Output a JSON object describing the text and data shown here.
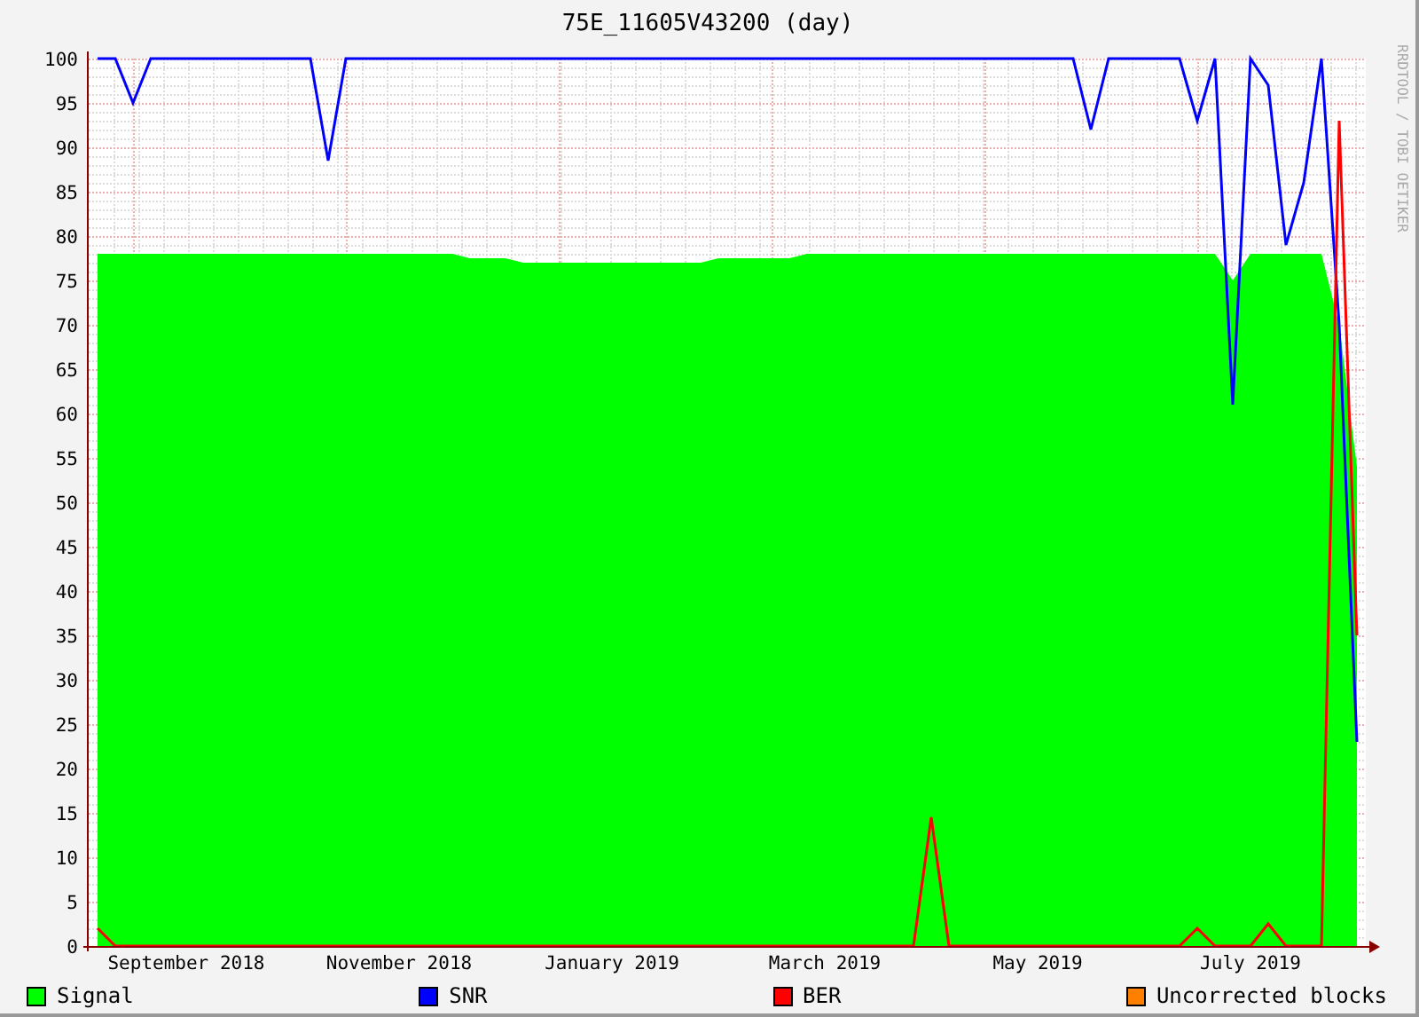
{
  "graph": {
    "title": "75E_11605V43200 (day)",
    "credit": "RRDTOOL / TOBI OETIKER",
    "chart_data": {
      "type": "area",
      "categories": [
        null,
        null,
        null,
        null,
        null,
        "September 2018",
        null,
        null,
        null,
        null,
        null,
        null,
        null,
        null,
        null,
        null,
        null,
        "November 2018",
        null,
        null,
        null,
        null,
        null,
        null,
        null,
        null,
        null,
        null,
        null,
        "January 2019",
        null,
        null,
        null,
        null,
        null,
        null,
        null,
        null,
        null,
        null,
        null,
        "March 2019",
        null,
        null,
        null,
        null,
        null,
        null,
        null,
        null,
        null,
        null,
        null,
        "May 2019",
        null,
        null,
        null,
        null,
        null,
        null,
        null,
        null,
        null,
        null,
        null,
        "July 2019",
        null,
        null,
        null,
        null,
        null,
        null
      ],
      "series": [
        {
          "name": "Signal",
          "type": "area",
          "color": "#00ff00",
          "values": [
            78,
            78,
            78,
            78,
            78,
            78,
            78,
            78,
            78,
            78,
            78,
            78,
            78,
            78,
            78,
            78,
            78,
            78,
            78,
            78,
            78,
            77.5,
            77.5,
            77.5,
            77,
            77,
            77,
            77,
            77,
            77,
            77,
            77,
            77,
            77,
            77,
            77.5,
            77.5,
            77.5,
            77.5,
            77.5,
            78,
            78,
            78,
            78,
            78,
            78,
            78,
            78,
            78,
            78,
            78,
            78,
            78,
            78,
            78,
            78,
            78,
            78,
            78,
            78,
            78,
            78,
            78,
            78,
            75,
            78,
            78,
            78,
            78,
            78,
            70,
            54
          ]
        },
        {
          "name": "SNR",
          "type": "line",
          "color": "#0000ff",
          "values": [
            100,
            100,
            95,
            100,
            100,
            100,
            100,
            100,
            100,
            100,
            100,
            100,
            100,
            88.5,
            100,
            100,
            100,
            100,
            100,
            100,
            100,
            100,
            100,
            100,
            100,
            100,
            100,
            100,
            100,
            100,
            100,
            100,
            100,
            100,
            100,
            100,
            100,
            100,
            100,
            100,
            100,
            100,
            100,
            100,
            100,
            100,
            100,
            100,
            100,
            100,
            100,
            100,
            100,
            100,
            100,
            100,
            92,
            100,
            100,
            100,
            100,
            100,
            93,
            100,
            61,
            100,
            97,
            79,
            86,
            100,
            70,
            23
          ]
        },
        {
          "name": "BER",
          "type": "line",
          "color": "#ff0000",
          "values": [
            2,
            0,
            0,
            0,
            0,
            0,
            0,
            0,
            0,
            0,
            0,
            0,
            0,
            0,
            0,
            0,
            0,
            0,
            0,
            0,
            0,
            0,
            0,
            0,
            0,
            0,
            0,
            0,
            0,
            0,
            0,
            0,
            0,
            0,
            0,
            0,
            0,
            0,
            0,
            0,
            0,
            0,
            0,
            0,
            0,
            0,
            0,
            14.5,
            0,
            0,
            0,
            0,
            0,
            0,
            0,
            0,
            0,
            0,
            0,
            0,
            0,
            0,
            2,
            0,
            0,
            0,
            2.5,
            0,
            0,
            0,
            93,
            35
          ]
        },
        {
          "name": "Uncorrected blocks",
          "color": "#ff8000",
          "values": [
            null,
            null,
            null,
            null,
            null,
            null,
            null,
            null,
            null,
            null,
            null,
            null,
            null,
            null,
            null,
            null,
            null,
            null,
            null,
            null,
            null,
            null,
            null,
            null,
            null,
            null,
            null,
            null,
            null,
            null,
            null,
            null,
            null,
            null,
            null,
            null,
            null,
            null,
            null,
            null,
            null,
            null,
            null,
            null,
            null,
            null,
            null,
            null,
            null,
            null,
            null,
            null,
            null,
            null,
            null,
            null,
            null,
            null,
            null,
            null,
            null,
            null,
            null,
            null,
            null,
            null,
            null,
            null,
            null,
            null,
            null,
            null
          ]
        }
      ],
      "grid": true,
      "ylim": [
        0,
        100
      ],
      "yticks": [
        0,
        5,
        10,
        15,
        20,
        25,
        30,
        35,
        40,
        45,
        50,
        55,
        60,
        65,
        70,
        75,
        80,
        85,
        90,
        95,
        100
      ]
    }
  }
}
